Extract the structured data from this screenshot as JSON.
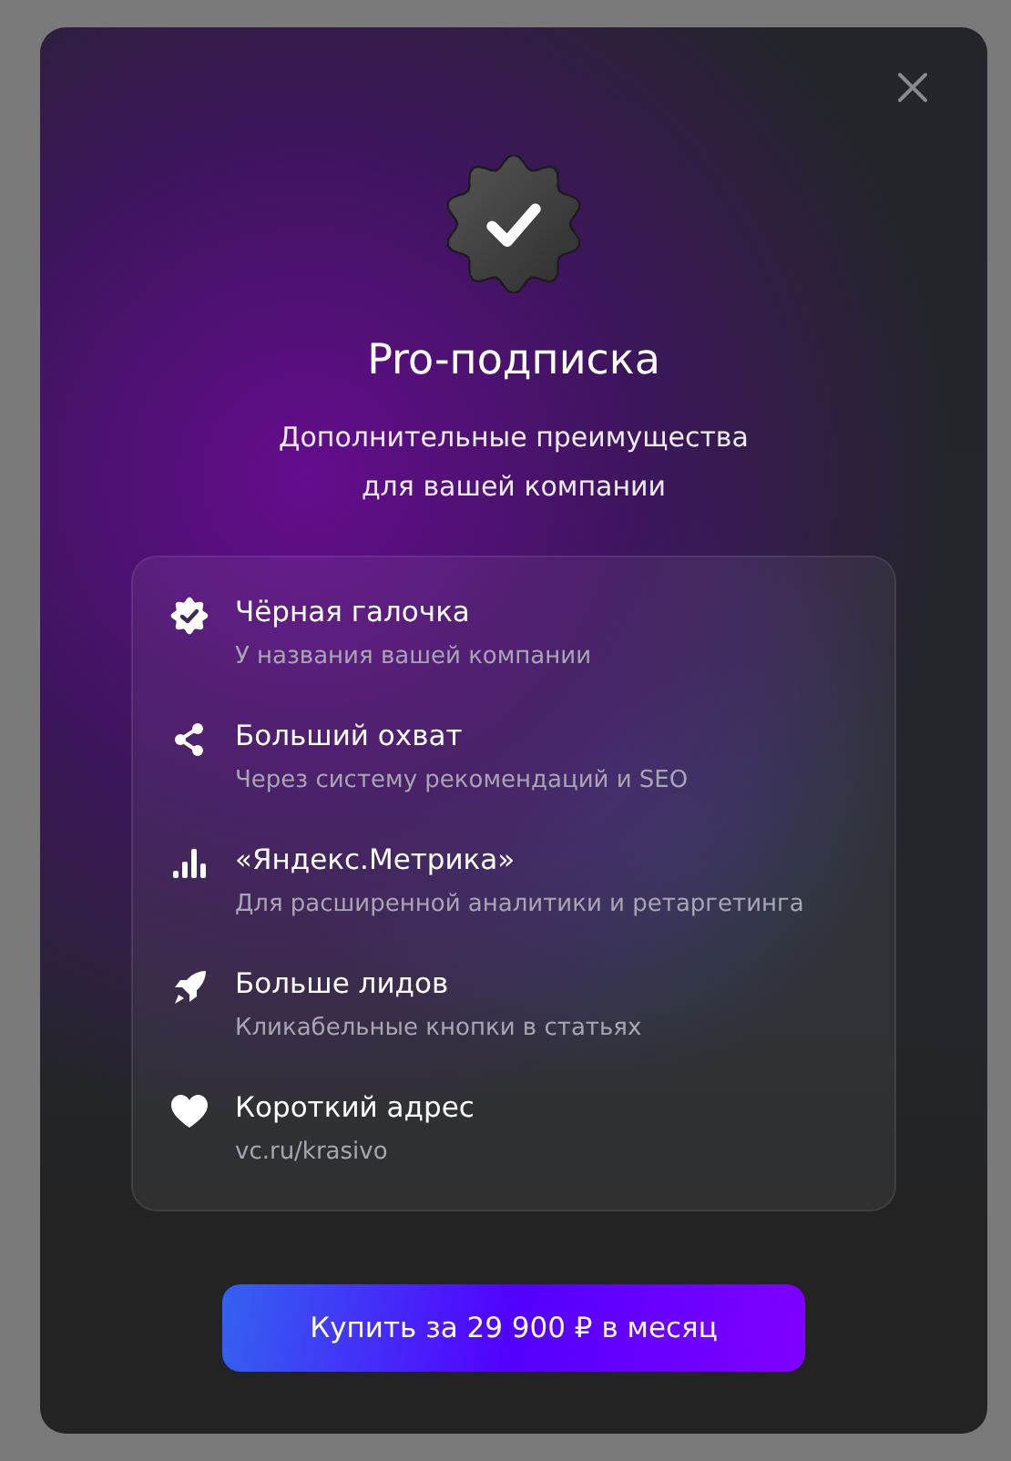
{
  "dialog": {
    "title": "Pro-подписка",
    "subtitle": "Дополнительные преимущества для вашей компании",
    "features": [
      {
        "kind": "badge",
        "title": "Чёрная галочка",
        "description": "У названия вашей компании"
      },
      {
        "kind": "share",
        "title": "Больший охват",
        "description": "Через систему рекомендаций и SEO"
      },
      {
        "kind": "chart",
        "title": "«Яндекс.Метрика»",
        "description": "Для расширенной аналитики и ретаргетинга"
      },
      {
        "kind": "rocket",
        "title": "Больше лидов",
        "description": "Кликабельные кнопки в статьях"
      },
      {
        "kind": "heart",
        "title": "Короткий адрес",
        "description": "vc.ru/krasivo"
      }
    ],
    "button": "Купить за 29 900 ₽ в месяц"
  }
}
